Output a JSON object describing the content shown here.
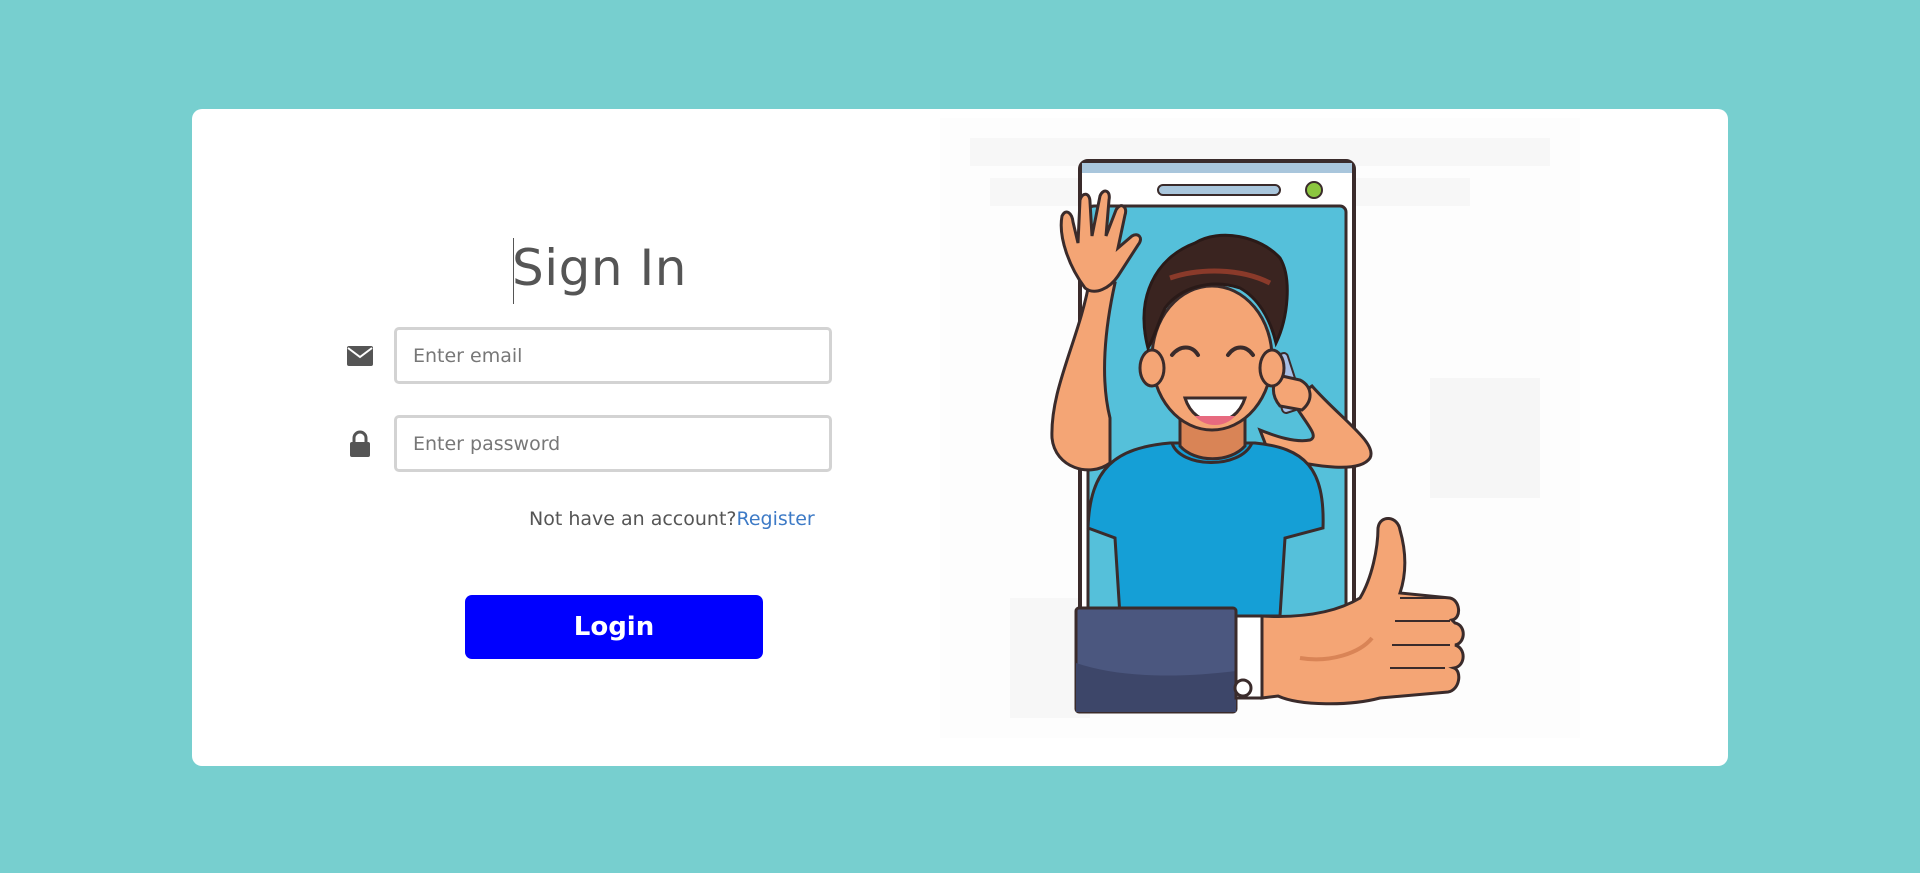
{
  "signin": {
    "title": "Sign In",
    "email_placeholder": "Enter email",
    "password_placeholder": "Enter password",
    "register_prompt": "Not have an account?",
    "register_link": "Register",
    "login_label": "Login"
  },
  "icons": {
    "email": "envelope-icon",
    "password": "lock-icon"
  },
  "colors": {
    "background": "#77cfcf",
    "card": "#ffffff",
    "button": "#0000ff",
    "link": "#3d7ac6",
    "text": "#555555"
  }
}
